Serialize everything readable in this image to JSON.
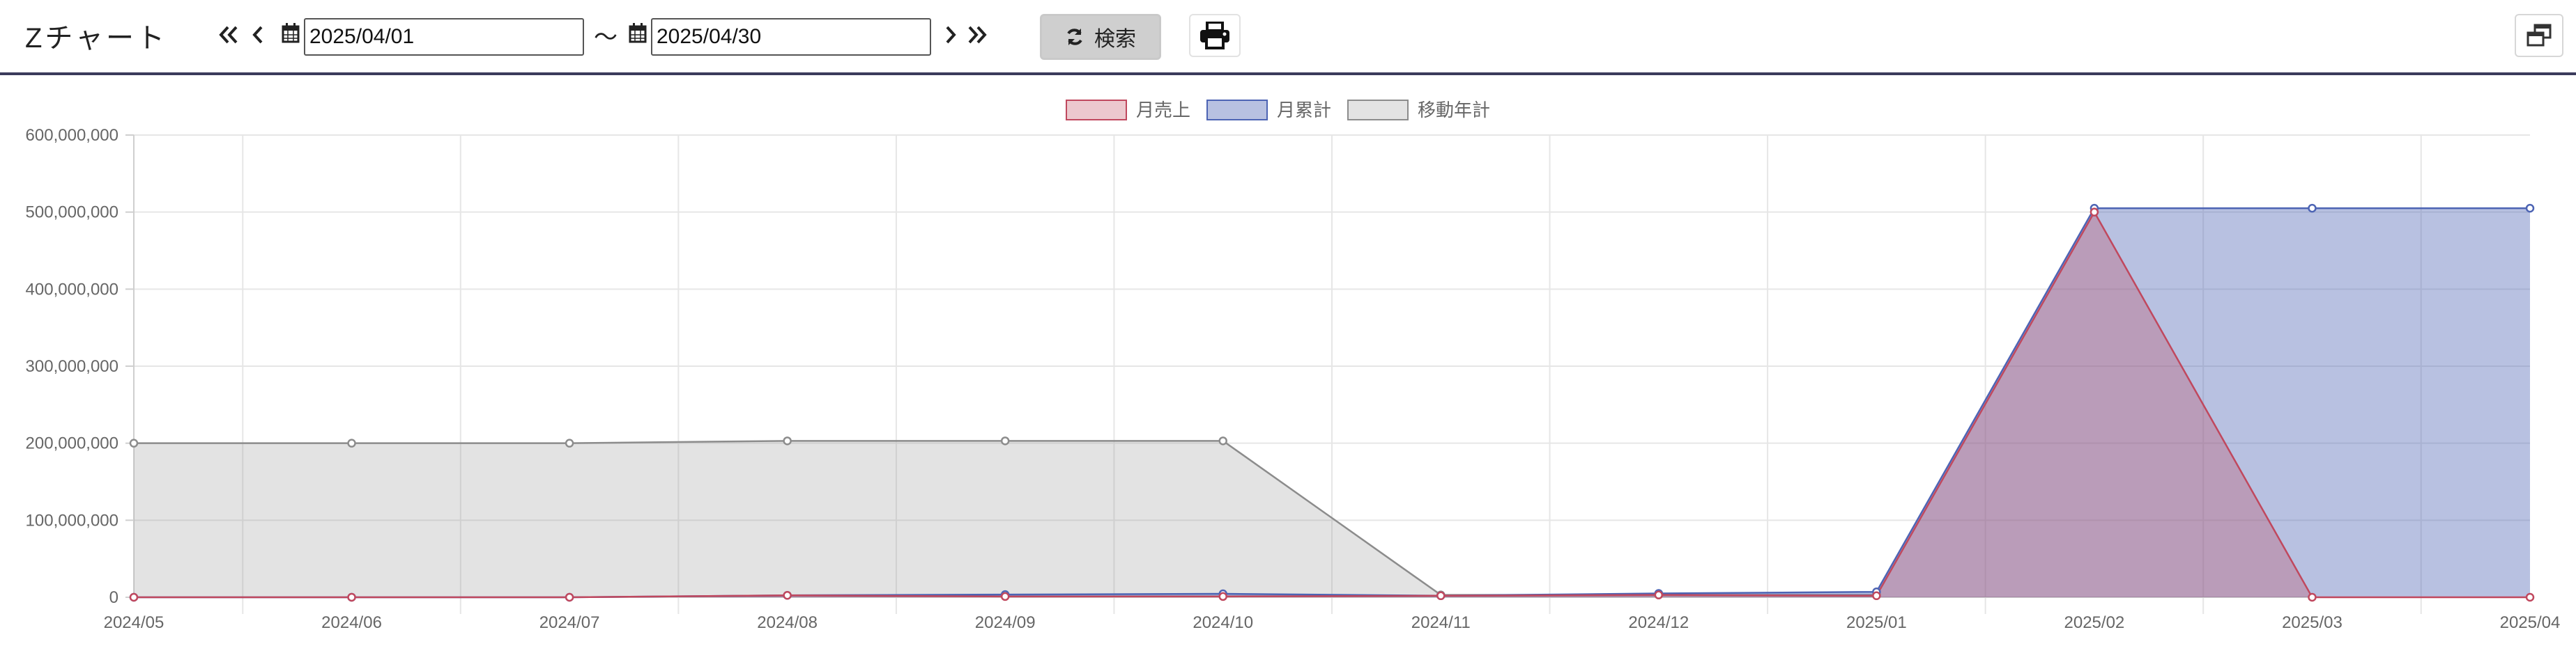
{
  "app": {
    "title": "Zチャート"
  },
  "toolbar": {
    "date_from": "2025/04/01",
    "date_to": "2025/04/30",
    "tilde": "～",
    "search_label": "検索"
  },
  "colors": {
    "monthly_sales": "#c0485e",
    "monthly_cumulative": "#4d64b4",
    "moving_annual": "#8c8c8c"
  },
  "chart_data": {
    "type": "area",
    "x": [
      "2024/05",
      "2024/06",
      "2024/07",
      "2024/08",
      "2024/09",
      "2024/10",
      "2024/11",
      "2024/12",
      "2025/01",
      "2025/02",
      "2025/03",
      "2025/04"
    ],
    "ylim": [
      0,
      600000000
    ],
    "yticks": [
      "0",
      "100,000,000",
      "200,000,000",
      "300,000,000",
      "400,000,000",
      "500,000,000",
      "600,000,000"
    ],
    "grid": true,
    "legend_position": "top-center",
    "series": [
      {
        "name": "月売上",
        "values": [
          0,
          0,
          0,
          2500000,
          1000000,
          1000000,
          2000000,
          3000000,
          2000000,
          500000000,
          0,
          0
        ]
      },
      {
        "name": "月累計",
        "values": [
          0,
          0,
          0,
          2500000,
          3500000,
          4500000,
          2000000,
          5000000,
          7000000,
          505000000,
          505000000,
          505000000
        ]
      },
      {
        "name": "移動年計",
        "values": [
          200000000,
          200000000,
          200000000,
          203000000,
          203000000,
          203000000,
          3000000,
          3000000,
          3000000,
          null,
          null,
          null
        ]
      }
    ]
  }
}
